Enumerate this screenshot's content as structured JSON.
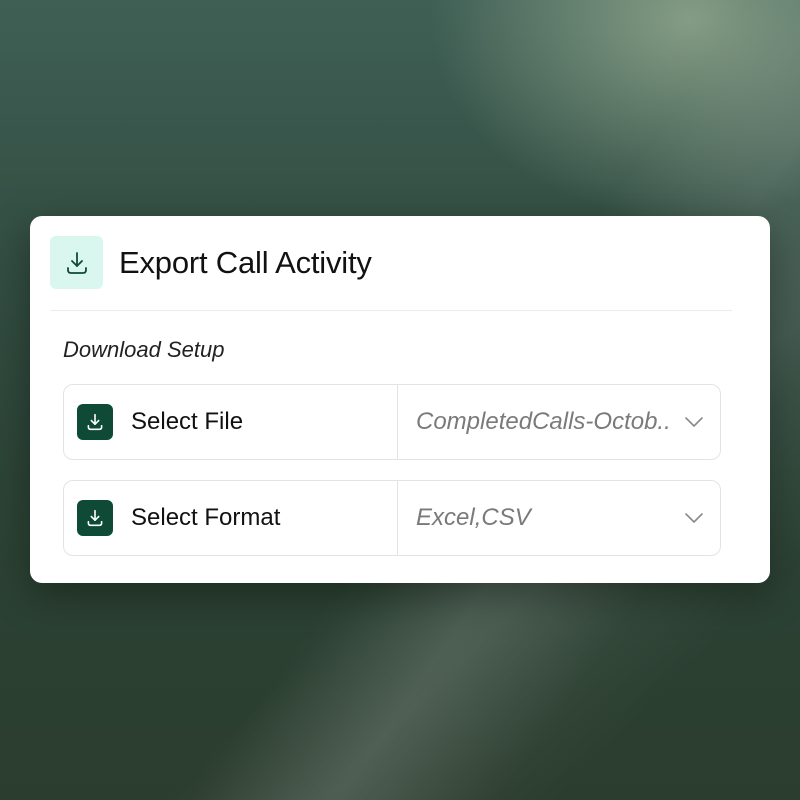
{
  "dialog": {
    "title": "Export Call Activity",
    "header_icon": "download-icon"
  },
  "section": {
    "label": "Download Setup"
  },
  "rows": [
    {
      "label": "Select File",
      "icon": "download-icon",
      "value": "CompletedCalls-Octob..",
      "chevron": "chevron-down-icon"
    },
    {
      "label": "Select Format",
      "icon": "download-icon",
      "value": "Excel,CSV",
      "chevron": "chevron-down-icon"
    }
  ],
  "colors": {
    "accent_dark": "#0f4a36",
    "accent_light": "#d9f7ef",
    "placeholder_text": "#7a7a7a"
  }
}
